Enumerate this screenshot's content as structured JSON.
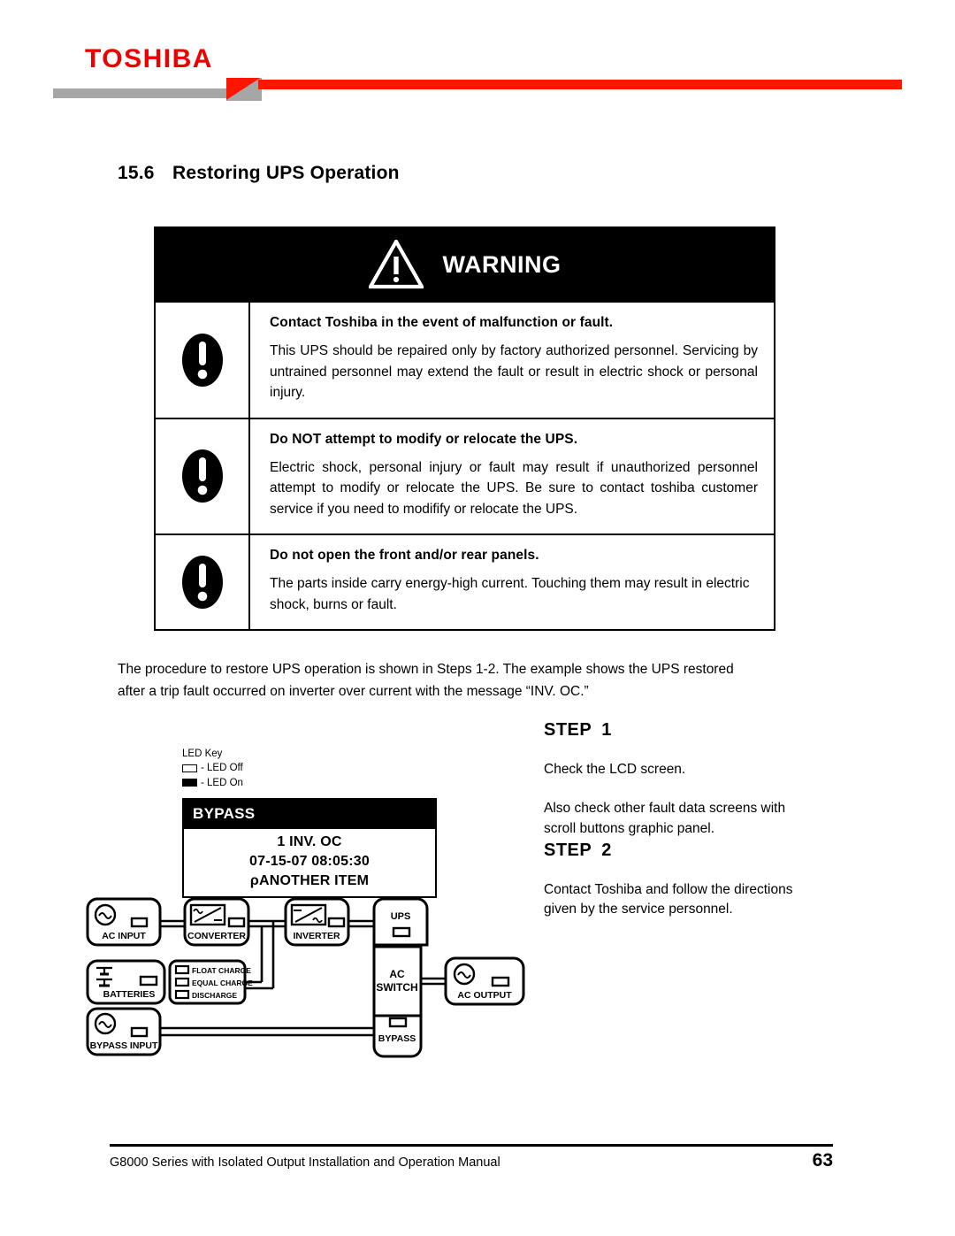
{
  "header": {
    "brand": "TOSHIBA"
  },
  "section": {
    "number": "15.6",
    "title": "Restoring UPS Operation"
  },
  "warning": {
    "banner_label": "WARNING",
    "banner_icon": "warning-triangle-icon",
    "rows": [
      {
        "icon": "exclamation-mark-icon",
        "title": "Contact Toshiba in the event of malfunction or fault.",
        "text": "This UPS should be repaired only by factory authorized personnel. Servicing by untrained personnel may extend the fault or result in electric shock or personal injury."
      },
      {
        "icon": "exclamation-mark-icon",
        "title": "Do NOT attempt to modify or relocate the UPS.",
        "text": "Electric shock, personal injury or fault may result if unauthorized personnel attempt to modify or relocate the UPS. Be sure to contact toshiba customer service if you need to modifify or relocate the UPS."
      },
      {
        "icon": "exclamation-mark-icon",
        "title": "Do not open the front and/or rear panels.",
        "text": "The parts inside carry energy-high current. Touching them may result in electric shock, burns or fault."
      }
    ]
  },
  "intro": {
    "line1": "The procedure to restore UPS operation is shown in Steps 1-2. The example shows the UPS restored",
    "line2": "after a trip fault occurred on inverter over current with the message “INV. OC.”"
  },
  "steps": [
    {
      "label": "STEP",
      "number": "1",
      "line1": "Check the LCD screen.",
      "line2": "Also check other fault data screens with",
      "line3": "scroll buttons graphic panel."
    },
    {
      "label": "STEP",
      "number": "2",
      "line1": "Contact Toshiba and follow the directions",
      "line2": "given by the service personnel."
    }
  ],
  "led_key": {
    "title": "LED Key",
    "off_label": "- LED Off",
    "on_label": "- LED On"
  },
  "lcd": {
    "status": "BYPASS",
    "line1": "1 INV. OC",
    "line2": "07-15-07 08:05:30",
    "line3": "ρANOTHER ITEM"
  },
  "diagram": {
    "blocks": [
      {
        "id": "ac-input",
        "label": "AC INPUT",
        "symbol": "ac-sine-circle-icon",
        "led": "off"
      },
      {
        "id": "converter",
        "label": "CONVERTER",
        "symbol": "ac-to-dc-icon",
        "led": "off"
      },
      {
        "id": "inverter",
        "label": "INVERTER",
        "symbol": "dc-to-ac-icon",
        "led": "off"
      },
      {
        "id": "ups",
        "label": "UPS",
        "symbol": "none",
        "led": "off"
      },
      {
        "id": "batteries",
        "label": "BATTERIES",
        "symbol": "battery-icon",
        "led": "off"
      },
      {
        "id": "bypass-input",
        "label": "BYPASS INPUT",
        "symbol": "ac-sine-circle-icon",
        "led": "off"
      },
      {
        "id": "ac-switch",
        "label": "AC SWITCH",
        "symbol": "none",
        "led": "none"
      },
      {
        "id": "bypass",
        "label": "BYPASS",
        "symbol": "none",
        "led": "off"
      },
      {
        "id": "ac-output",
        "label": "AC OUTPUT",
        "symbol": "ac-sine-circle-icon",
        "led": "off"
      }
    ],
    "charge_states": [
      {
        "id": "float-charge",
        "label": "FLOAT CHARGE",
        "led": "off"
      },
      {
        "id": "equal-charge",
        "label": "EQUAL CHARGE",
        "led": "off"
      },
      {
        "id": "discharge",
        "label": "DISCHARGE",
        "led": "off"
      }
    ],
    "ac_switch_line1": "AC",
    "ac_switch_line2": "SWITCH"
  },
  "footer": {
    "manual": "G8000 Series with Isolated Output Installation and Operation Manual",
    "page": "63"
  },
  "colors": {
    "brand_red": "#ee0000",
    "rule_red": "#ff1500",
    "rule_gray": "#a6a6a6",
    "ink": "#000000"
  }
}
